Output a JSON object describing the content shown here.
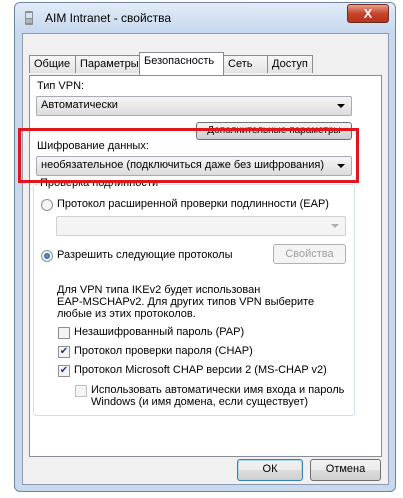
{
  "window": {
    "title": "AIM Intranet - свойства",
    "title_icon": "phone-connection-icon",
    "close_glyph": "X"
  },
  "tabs": [
    {
      "label": "Общие",
      "active": false
    },
    {
      "label": "Параметры",
      "active": false
    },
    {
      "label": "Безопасность",
      "active": true
    },
    {
      "label": "Сеть",
      "active": false
    },
    {
      "label": "Доступ",
      "active": false
    }
  ],
  "vpn_type": {
    "label": "Тип VPN:",
    "value": "Автоматически"
  },
  "advanced_button": "Дополнительные параметры",
  "encryption": {
    "label": "Шифрование данных:",
    "value": "необязательное (подключиться даже без шифрования)"
  },
  "auth": {
    "group_label": "Проверка подлинности",
    "eap_radio": "Протокол расширенной проверки подлинности (EAP)",
    "eap_combo_value": "",
    "allow_radio": "Разрешить следующие протоколы",
    "properties_button": "Свойства",
    "info_lines": [
      "Для VPN типа IKEv2 будет использован",
      "EAP-MSCHAPv2. Для других типов VPN выберите",
      "любые из этих протоколов."
    ],
    "pap_label": "Незашифрованный пароль (PAP)",
    "chap_label": "Протокол проверки пароля (CHAP)",
    "mschap_label": "Протокол Microsoft CHAP версии 2 (MS-CHAP v2)",
    "auto_logon_lines": [
      "Использовать автоматически имя входа и пароль",
      "Windows (и имя домена, если существует)"
    ],
    "pap_checked": false,
    "chap_checked": true,
    "mschap_checked": true,
    "auto_logon_checked": false
  },
  "ok_button": "ОК",
  "cancel_button": "Отмена",
  "highlight_color": "#e0161e"
}
